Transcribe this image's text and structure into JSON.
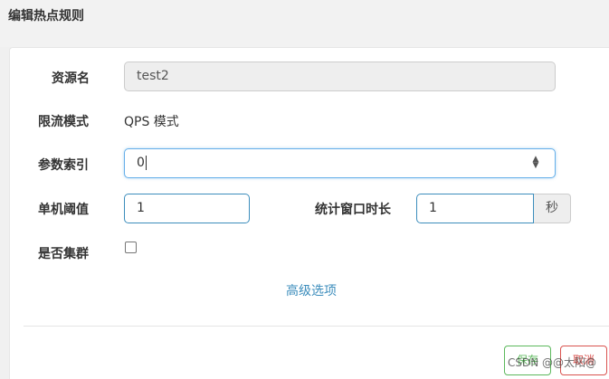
{
  "dialog": {
    "title": "编辑热点规则"
  },
  "form": {
    "resource_label": "资源名",
    "resource_value": "test2",
    "mode_label": "限流模式",
    "mode_value": "QPS 模式",
    "param_index_label": "参数索引",
    "param_index_value": "0",
    "threshold_label": "单机阈值",
    "threshold_value": "1",
    "window_label": "统计窗口时长",
    "window_value": "1",
    "window_unit": "秒",
    "cluster_label": "是否集群",
    "cluster_checked": false,
    "advanced_link": "高级选项"
  },
  "footer": {
    "save_label": "保存",
    "cancel_label": "取消"
  },
  "watermark": "CSDN @@太阳@"
}
